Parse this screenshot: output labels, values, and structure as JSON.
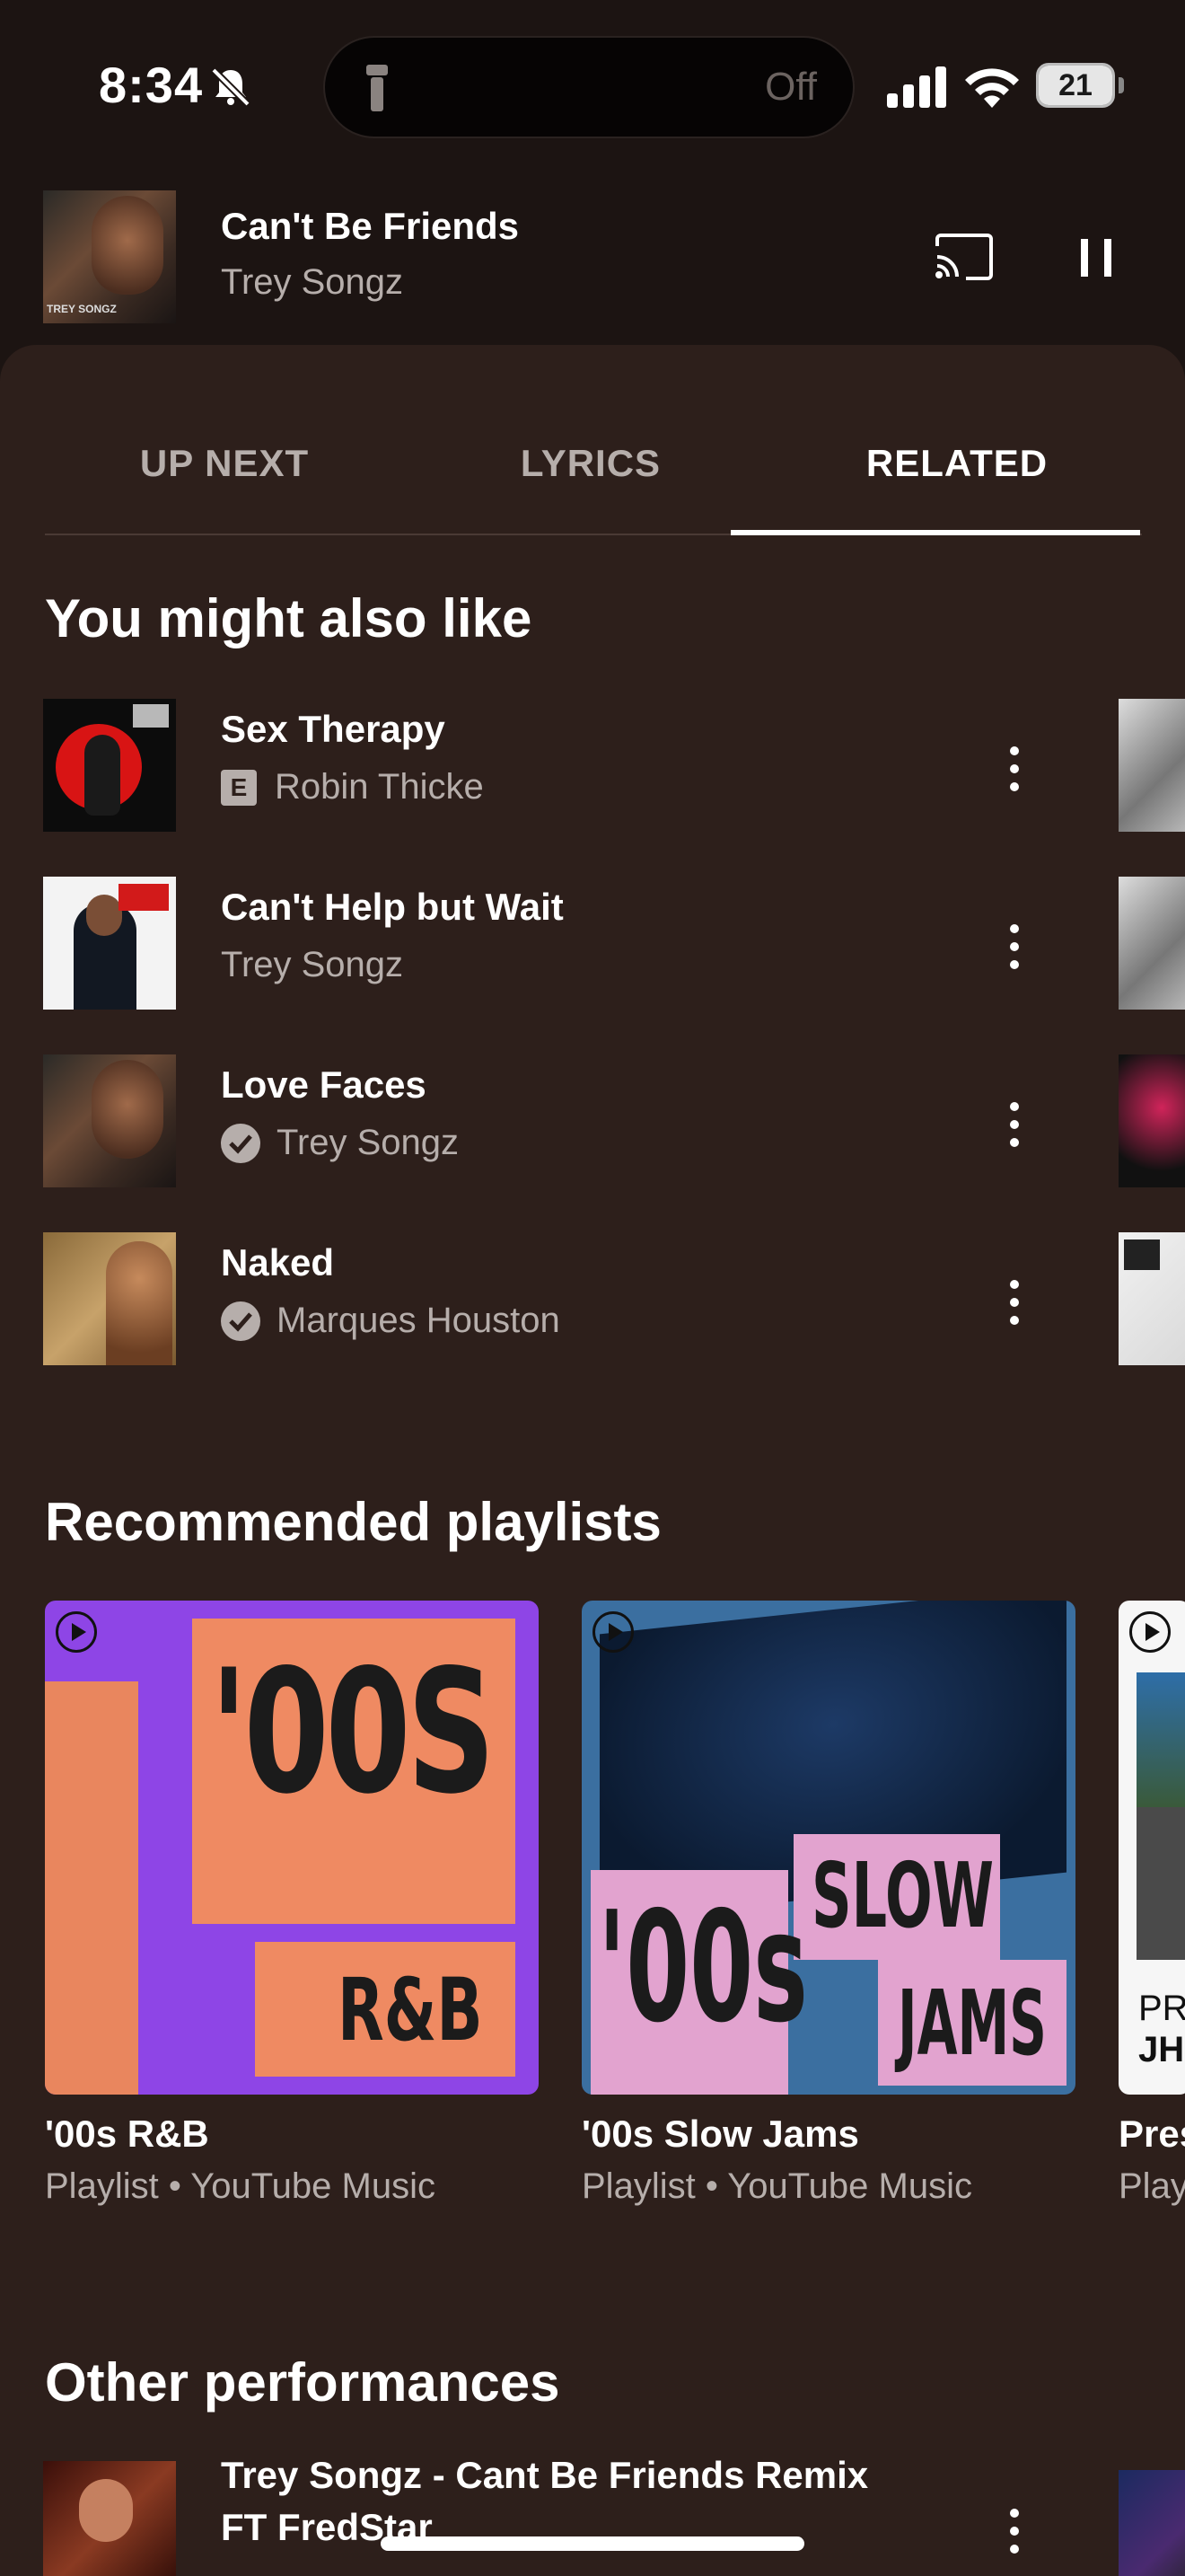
{
  "status_bar": {
    "time": "8:34",
    "island_label": "Off",
    "battery": "21"
  },
  "mini_player": {
    "title": "Can't Be Friends",
    "artist": "Trey Songz",
    "art_caption": "TREY SONGZ"
  },
  "tabs": [
    {
      "label": "UP NEXT",
      "active": false
    },
    {
      "label": "LYRICS",
      "active": false
    },
    {
      "label": "RELATED",
      "active": true
    }
  ],
  "sections": {
    "you_might_like": "You might also like",
    "recommended": "Recommended playlists",
    "other_performances": "Other performances"
  },
  "songs": [
    {
      "title": "Sex Therapy",
      "artist": "Robin Thicke",
      "badge": "E"
    },
    {
      "title": "Can't Help but Wait",
      "artist": "Trey Songz",
      "badge": ""
    },
    {
      "title": "Love Faces",
      "artist": "Trey Songz",
      "badge": "check"
    },
    {
      "title": "Naked",
      "artist": "Marques Houston",
      "badge": "check"
    }
  ],
  "playlists": [
    {
      "title": "'00s R&B",
      "subtitle": "Playlist • YouTube Music",
      "art_text_1": "'00S",
      "art_text_2": "R&B"
    },
    {
      "title": "'00s Slow Jams",
      "subtitle": "Playlist • YouTube Music",
      "art_text_1": "'00s",
      "art_text_2": "SLOW",
      "art_text_3": "JAMS"
    },
    {
      "title": "Pres",
      "subtitle": "Play",
      "art_text_1": "PR",
      "art_text_2": "JHI"
    }
  ],
  "other_performance": {
    "title_line1": "Trey Songz - Cant Be Friends Remix",
    "title_line2": "FT FredStar"
  },
  "colors": {
    "background": "#1c1412",
    "sheet": "#2d1f1b",
    "secondary_text": "#b6aeab"
  }
}
